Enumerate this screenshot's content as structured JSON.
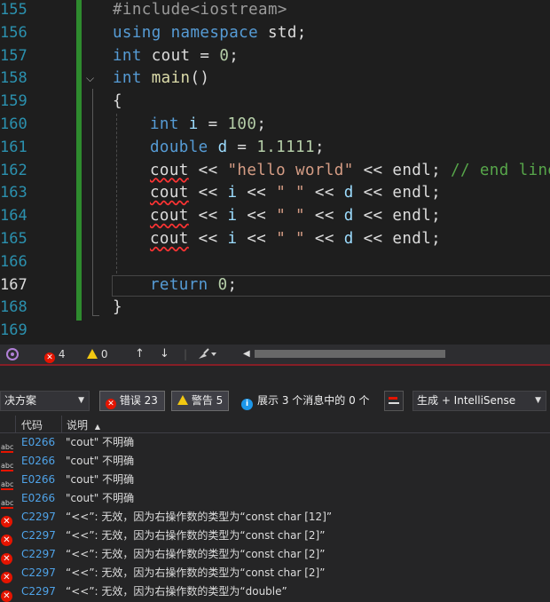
{
  "editor": {
    "lines": [
      {
        "n": "155",
        "tokens": [
          {
            "t": "#include",
            "c": "pp"
          },
          {
            "t": "<iostream>",
            "c": "pp"
          }
        ]
      },
      {
        "n": "156",
        "tokens": [
          {
            "t": "using",
            "c": "kw"
          },
          {
            "t": " "
          },
          {
            "t": "namespace",
            "c": "kw"
          },
          {
            "t": " std;",
            "c": "id"
          }
        ]
      },
      {
        "n": "157",
        "tokens": [
          {
            "t": "int",
            "c": "kw"
          },
          {
            "t": " cout = ",
            "c": "id"
          },
          {
            "t": "0",
            "c": "num"
          },
          {
            "t": ";",
            "c": "id"
          }
        ]
      },
      {
        "n": "158",
        "tokens": [
          {
            "t": "int",
            "c": "kw"
          },
          {
            "t": " "
          },
          {
            "t": "main",
            "c": "fn"
          },
          {
            "t": "()",
            "c": "id"
          }
        ]
      },
      {
        "n": "159",
        "tokens": [
          {
            "t": "{",
            "c": "id"
          }
        ]
      },
      {
        "n": "160",
        "tokens": [
          {
            "t": "int",
            "c": "kw"
          },
          {
            "t": " "
          },
          {
            "t": "i",
            "c": "var"
          },
          {
            "t": " = ",
            "c": "id"
          },
          {
            "t": "100",
            "c": "num"
          },
          {
            "t": ";",
            "c": "id"
          }
        ]
      },
      {
        "n": "161",
        "tokens": [
          {
            "t": "double",
            "c": "kw"
          },
          {
            "t": " "
          },
          {
            "t": "d",
            "c": "var"
          },
          {
            "t": " = ",
            "c": "id"
          },
          {
            "t": "1.1111",
            "c": "num"
          },
          {
            "t": ";",
            "c": "id"
          }
        ]
      },
      {
        "n": "162",
        "tokens": [
          {
            "t": "cout",
            "c": "id sq"
          },
          {
            "t": " << ",
            "c": "id"
          },
          {
            "t": "\"hello world\"",
            "c": "str"
          },
          {
            "t": " << endl; ",
            "c": "id"
          },
          {
            "t": "// end line",
            "c": "cm"
          }
        ]
      },
      {
        "n": "163",
        "tokens": [
          {
            "t": "cout",
            "c": "id sq"
          },
          {
            "t": " << ",
            "c": "id"
          },
          {
            "t": "i",
            "c": "var"
          },
          {
            "t": " << ",
            "c": "id"
          },
          {
            "t": "\" \"",
            "c": "str"
          },
          {
            "t": " << ",
            "c": "id"
          },
          {
            "t": "d",
            "c": "var"
          },
          {
            "t": " << endl;",
            "c": "id"
          }
        ]
      },
      {
        "n": "164",
        "tokens": [
          {
            "t": "cout",
            "c": "id sq"
          },
          {
            "t": " << ",
            "c": "id"
          },
          {
            "t": "i",
            "c": "var"
          },
          {
            "t": " << ",
            "c": "id"
          },
          {
            "t": "\" \"",
            "c": "str"
          },
          {
            "t": " << ",
            "c": "id"
          },
          {
            "t": "d",
            "c": "var"
          },
          {
            "t": " << endl;",
            "c": "id"
          }
        ]
      },
      {
        "n": "165",
        "tokens": [
          {
            "t": "cout",
            "c": "id sq"
          },
          {
            "t": " << ",
            "c": "id"
          },
          {
            "t": "i",
            "c": "var"
          },
          {
            "t": " << ",
            "c": "id"
          },
          {
            "t": "\" \"",
            "c": "str"
          },
          {
            "t": " << ",
            "c": "id"
          },
          {
            "t": "d",
            "c": "var"
          },
          {
            "t": " << endl;",
            "c": "id"
          }
        ]
      },
      {
        "n": "166",
        "tokens": []
      },
      {
        "n": "167",
        "tokens": [
          {
            "t": "return",
            "c": "kw"
          },
          {
            "t": " "
          },
          {
            "t": "0",
            "c": "num"
          },
          {
            "t": ";",
            "c": "id"
          }
        ]
      },
      {
        "n": "168",
        "tokens": [
          {
            "t": "}",
            "c": "id"
          }
        ]
      },
      {
        "n": "169",
        "tokens": []
      }
    ],
    "active_line": "167"
  },
  "strip": {
    "errors": "4",
    "warnings": "0",
    "up_arrow": "↑",
    "down_arrow": "↓"
  },
  "errorlist": {
    "scope_value": "决方案",
    "errors_button": "错误 23",
    "warnings_button": "警告 5",
    "messages_button": "展示 3 个消息中的 0 个",
    "build_source": "生成 + IntelliSense",
    "col_code": "代码",
    "col_desc": "说明",
    "rows": [
      {
        "kind": "intellisense",
        "code": "E0266",
        "desc": "\"cout\" 不明确"
      },
      {
        "kind": "intellisense",
        "code": "E0266",
        "desc": "\"cout\" 不明确"
      },
      {
        "kind": "intellisense",
        "code": "E0266",
        "desc": "\"cout\" 不明确"
      },
      {
        "kind": "intellisense",
        "code": "E0266",
        "desc": "\"cout\" 不明确"
      },
      {
        "kind": "error",
        "code": "C2297",
        "desc": "“<<”: 无效，因为右操作数的类型为“const char [12]”"
      },
      {
        "kind": "error",
        "code": "C2297",
        "desc": "“<<”: 无效，因为右操作数的类型为“const char [2]”"
      },
      {
        "kind": "error",
        "code": "C2297",
        "desc": "“<<”: 无效，因为右操作数的类型为“const char [2]”"
      },
      {
        "kind": "error",
        "code": "C2297",
        "desc": "“<<”: 无效，因为右操作数的类型为“const char [2]”"
      },
      {
        "kind": "error",
        "code": "C2297",
        "desc": "“<<”: 无效，因为右操作数的类型为“double”"
      }
    ]
  }
}
